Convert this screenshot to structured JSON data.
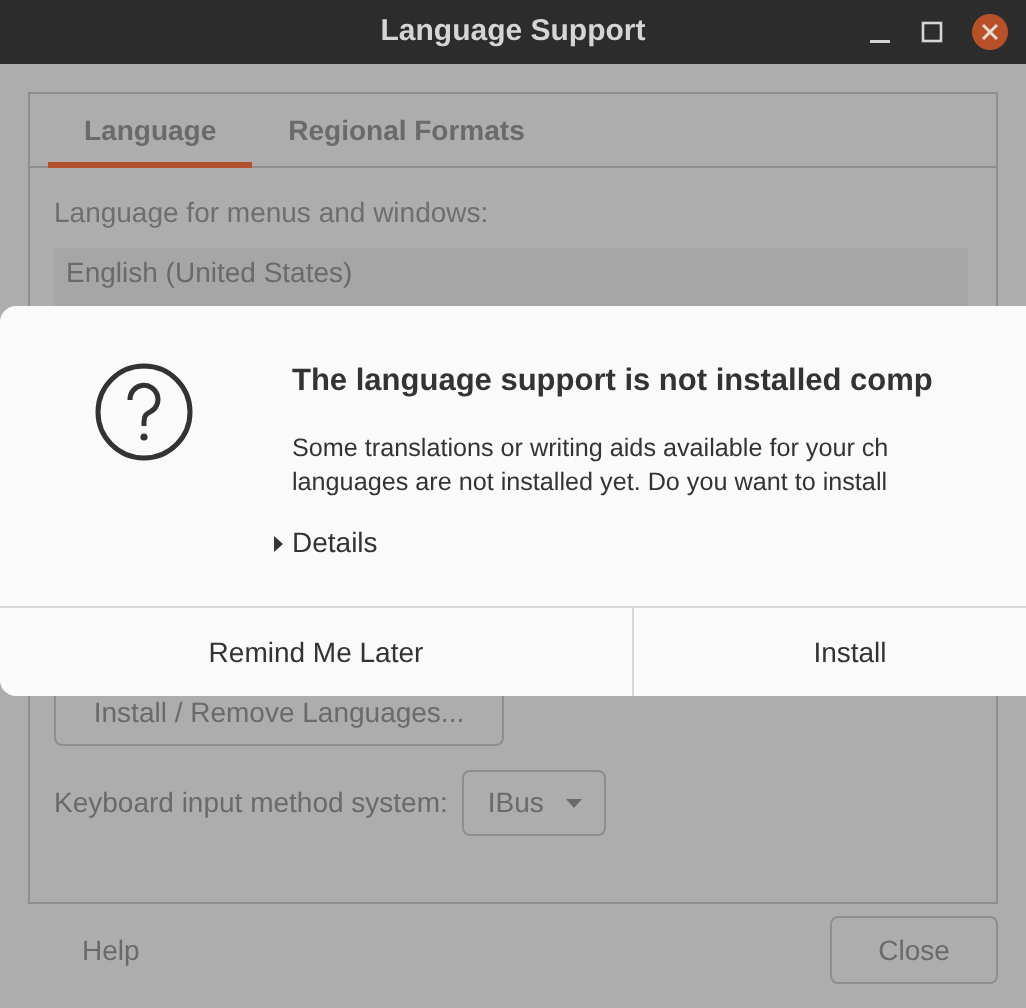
{
  "window": {
    "title": "Language Support"
  },
  "tabs": [
    {
      "label": "Language",
      "selected": true
    },
    {
      "label": "Regional Formats",
      "selected": false
    }
  ],
  "language_section": {
    "label": "Language for menus and windows:",
    "items": [
      "English (United States)"
    ]
  },
  "install_remove_button": "Install / Remove Languages...",
  "input_method": {
    "label": "Keyboard input method system:",
    "value": "IBus"
  },
  "footer": {
    "help": "Help",
    "close": "Close"
  },
  "dialog": {
    "title": "The language support is not installed comp",
    "message": [
      "Some translations or writing aids available for your ch",
      "languages are not installed yet. Do you want to install"
    ],
    "details": {
      "label": "Details",
      "expanded": false
    },
    "buttons": [
      "Remind Me Later",
      "Install"
    ]
  }
}
